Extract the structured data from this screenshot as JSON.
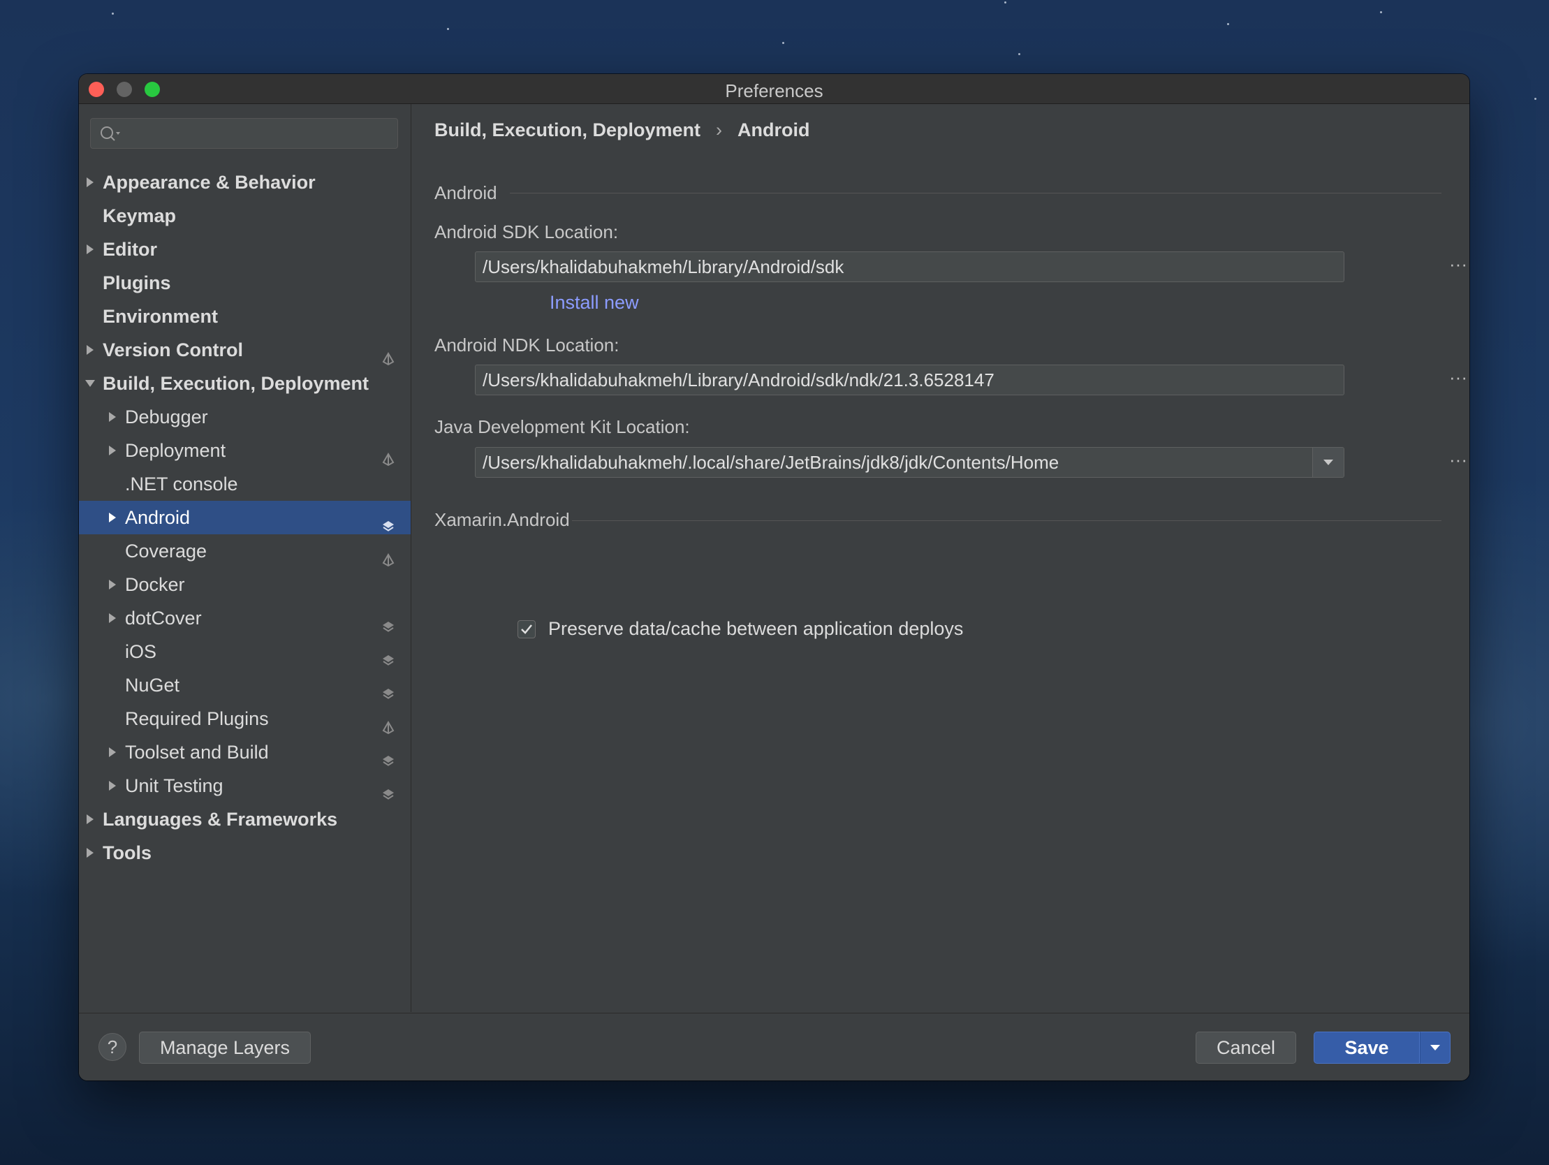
{
  "window": {
    "title": "Preferences"
  },
  "search": {
    "placeholder": ""
  },
  "sidebar": {
    "items": [
      {
        "label": "Appearance & Behavior",
        "depth": 0,
        "arrow": "right",
        "bold": true,
        "layer": "none",
        "selected": false
      },
      {
        "label": "Keymap",
        "depth": 0,
        "arrow": "none",
        "bold": true,
        "layer": "none",
        "selected": false
      },
      {
        "label": "Editor",
        "depth": 0,
        "arrow": "right",
        "bold": true,
        "layer": "none",
        "selected": false
      },
      {
        "label": "Plugins",
        "depth": 0,
        "arrow": "none",
        "bold": true,
        "layer": "none",
        "selected": false
      },
      {
        "label": "Environment",
        "depth": 0,
        "arrow": "none",
        "bold": true,
        "layer": "none",
        "selected": false
      },
      {
        "label": "Version Control",
        "depth": 0,
        "arrow": "right",
        "bold": true,
        "layer": "single",
        "selected": false
      },
      {
        "label": "Build, Execution, Deployment",
        "depth": 0,
        "arrow": "down",
        "bold": true,
        "layer": "none",
        "selected": false
      },
      {
        "label": "Debugger",
        "depth": 1,
        "arrow": "right",
        "bold": false,
        "layer": "none",
        "selected": false
      },
      {
        "label": "Deployment",
        "depth": 1,
        "arrow": "right",
        "bold": false,
        "layer": "single",
        "selected": false
      },
      {
        "label": ".NET console",
        "depth": 1,
        "arrow": "none",
        "bold": false,
        "layer": "none",
        "selected": false
      },
      {
        "label": "Android",
        "depth": 1,
        "arrow": "right",
        "bold": false,
        "layer": "stack",
        "selected": true
      },
      {
        "label": "Coverage",
        "depth": 1,
        "arrow": "none",
        "bold": false,
        "layer": "single",
        "selected": false
      },
      {
        "label": "Docker",
        "depth": 1,
        "arrow": "right",
        "bold": false,
        "layer": "none",
        "selected": false
      },
      {
        "label": "dotCover",
        "depth": 1,
        "arrow": "right",
        "bold": false,
        "layer": "stack",
        "selected": false
      },
      {
        "label": "iOS",
        "depth": 1,
        "arrow": "none",
        "bold": false,
        "layer": "stack",
        "selected": false
      },
      {
        "label": "NuGet",
        "depth": 1,
        "arrow": "none",
        "bold": false,
        "layer": "stack",
        "selected": false
      },
      {
        "label": "Required Plugins",
        "depth": 1,
        "arrow": "none",
        "bold": false,
        "layer": "single",
        "selected": false
      },
      {
        "label": "Toolset and Build",
        "depth": 1,
        "arrow": "right",
        "bold": false,
        "layer": "stack",
        "selected": false
      },
      {
        "label": "Unit Testing",
        "depth": 1,
        "arrow": "right",
        "bold": false,
        "layer": "stack",
        "selected": false
      },
      {
        "label": "Languages & Frameworks",
        "depth": 0,
        "arrow": "right",
        "bold": true,
        "layer": "none",
        "selected": false
      },
      {
        "label": "Tools",
        "depth": 0,
        "arrow": "right",
        "bold": true,
        "layer": "none",
        "selected": false
      }
    ]
  },
  "breadcrumb": {
    "parent": "Build, Execution, Deployment",
    "separator": "›",
    "current": "Android"
  },
  "android_section": {
    "title": "Android",
    "sdk_label": "Android SDK Location:",
    "sdk_value": "/Users/khalidabuhakmeh/Library/Android/sdk",
    "install_new": "Install new",
    "ndk_label": "Android NDK Location:",
    "ndk_value": "/Users/khalidabuhakmeh/Library/Android/sdk/ndk/21.3.6528147",
    "jdk_label": "Java Development Kit Location:",
    "jdk_value": "/Users/khalidabuhakmeh/.local/share/JetBrains/jdk8/jdk/Contents/Home",
    "browse": "···"
  },
  "xamarin_section": {
    "title": "Xamarin.Android",
    "preserve_label": "Preserve data/cache between application deploys",
    "preserve_checked": true
  },
  "footer": {
    "help": "?",
    "manage_layers": "Manage Layers",
    "cancel": "Cancel",
    "save": "Save"
  },
  "colors": {
    "accent": "#365da8",
    "selection": "#2f4f86",
    "link": "#8c9cff",
    "reset_icon": "#4a9eff"
  }
}
